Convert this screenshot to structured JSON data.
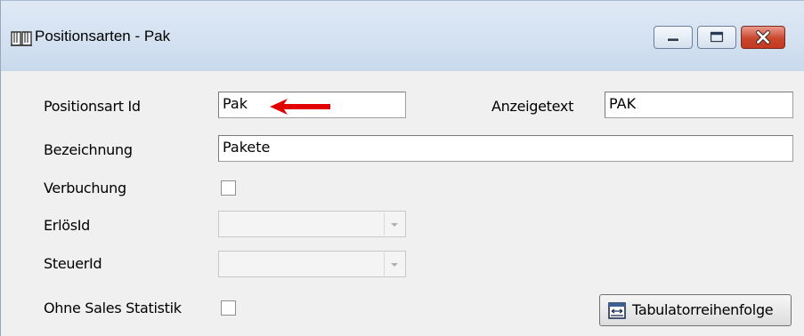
{
  "window": {
    "title": "Positionsarten - Pak",
    "icons": {
      "app": "book-icon",
      "minimize": "minimize-icon",
      "maximize": "maximize-icon",
      "close": "close-icon"
    },
    "colors": {
      "close_button": "#c9472e",
      "annotation_arrow": "#e00000"
    }
  },
  "form": {
    "positionsart_id": {
      "label": "Positionsart Id",
      "value": "Pak"
    },
    "anzeigetext": {
      "label": "Anzeigetext",
      "value": "PAK"
    },
    "bezeichnung": {
      "label": "Bezeichnung",
      "value": "Pakete"
    },
    "verbuchung": {
      "label": "Verbuchung",
      "checked": false
    },
    "erloes_id": {
      "label": "ErlösId",
      "value": ""
    },
    "steuer_id": {
      "label": "SteuerId",
      "value": ""
    },
    "ohne_sales_statistik": {
      "label": "Ohne Sales Statistik",
      "checked": false
    },
    "tab_order_button": {
      "label": "Tabulatorreihenfolge",
      "icon": "tab-order-icon"
    }
  }
}
